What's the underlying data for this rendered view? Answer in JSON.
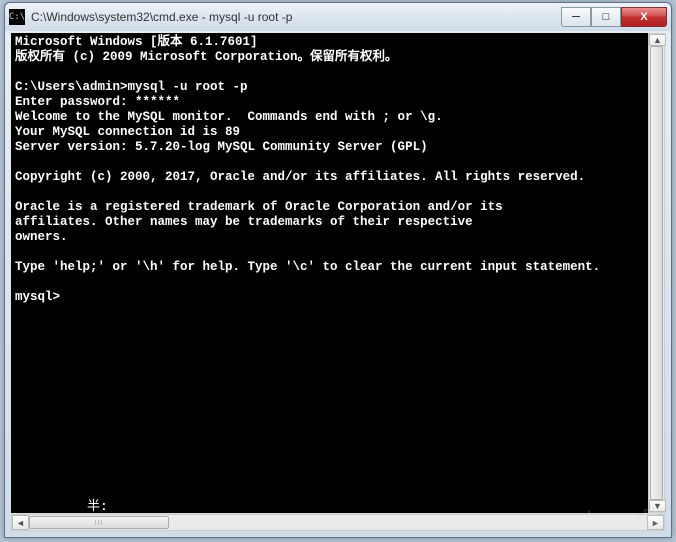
{
  "window": {
    "title": "C:\\Windows\\system32\\cmd.exe - mysql  -u root -p",
    "icon_label": "C:\\"
  },
  "controls": {
    "minimize": "─",
    "maximize": "□",
    "close": "X"
  },
  "terminal": {
    "lines": [
      "Microsoft Windows [版本 6.1.7601]",
      "版权所有 (c) 2009 Microsoft Corporation。保留所有权利。",
      "",
      "C:\\Users\\admin>mysql -u root -p",
      "Enter password: ******",
      "Welcome to the MySQL monitor.  Commands end with ; or \\g.",
      "Your MySQL connection id is 89",
      "Server version: 5.7.20-log MySQL Community Server (GPL)",
      "",
      "Copyright (c) 2000, 2017, Oracle and/or its affiliates. All rights reserved.",
      "",
      "Oracle is a registered trademark of Oracle Corporation and/or its",
      "affiliates. Other names may be trademarks of their respective",
      "owners.",
      "",
      "Type 'help;' or '\\h' for help. Type '\\c' to clear the current input statement.",
      "",
      "mysql>"
    ]
  },
  "ime": {
    "text": "半:"
  },
  "scroll": {
    "left": "◄",
    "right": "►",
    "up": "▲",
    "down": "▼"
  },
  "watermark": "php m x 网"
}
